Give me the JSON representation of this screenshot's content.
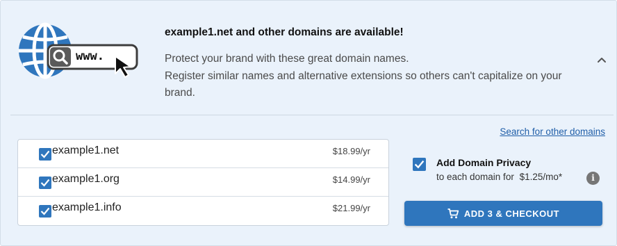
{
  "header": {
    "headline": "example1.net and other domains are available!",
    "desc_line1": "Protect your brand with these great domain names.",
    "desc_line2": "Register similar names and alternative extensions so others can't capitalize on your brand.",
    "logo_text": "www."
  },
  "search_link": "Search for other domains",
  "domains": [
    {
      "name": "example1.net",
      "price": "$18.99/yr",
      "checked": true
    },
    {
      "name": "example1.org",
      "price": "$14.99/yr",
      "checked": true
    },
    {
      "name": "example1.info",
      "price": "$21.99/yr",
      "checked": true
    }
  ],
  "privacy": {
    "title": "Add Domain Privacy",
    "sub_prefix": "to each domain for",
    "amount": "$1.25/mo*",
    "checked": true
  },
  "checkout": {
    "label": "ADD 3 & CHECKOUT"
  },
  "colors": {
    "accent": "#2f76bd",
    "panel_bg": "#eaf2fb",
    "link": "#1f5ea8"
  },
  "icons": [
    "globe-icon",
    "search-icon",
    "cursor-arrow-icon",
    "chevron-up-icon",
    "checkbox-checked-icon",
    "info-icon",
    "cart-icon"
  ]
}
